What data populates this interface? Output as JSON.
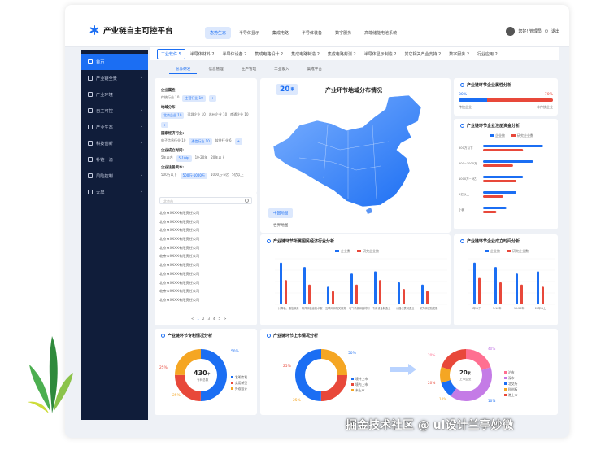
{
  "app": {
    "title": "产业链自主可控平台"
  },
  "topnav": [
    "态势生态",
    "半导体显示",
    "集成电路",
    "半导体装备",
    "数字服务",
    "高端储能电池系统"
  ],
  "user": {
    "name": "您好! 管理员",
    "logout": "退出"
  },
  "sidebar": [
    {
      "label": "首页",
      "icon": "home-icon"
    },
    {
      "label": "产业链全景",
      "icon": "network-icon"
    },
    {
      "label": "产业环境",
      "icon": "environment-icon"
    },
    {
      "label": "自主可控",
      "icon": "shield-icon"
    },
    {
      "label": "产业生态",
      "icon": "ecosystem-icon"
    },
    {
      "label": "科技创新",
      "icon": "innovation-icon"
    },
    {
      "label": "补链一滴",
      "icon": "chain-icon"
    },
    {
      "label": "风险控制",
      "icon": "risk-icon"
    },
    {
      "label": "大屏",
      "icon": "screen-icon"
    }
  ],
  "tabs_main": [
    "工业软件 5",
    "半导体材料 2",
    "半导体设备 2",
    "集成电路设计 2",
    "集成电路制造 2",
    "集成电路封测 2",
    "半导体显示制造 2",
    "其它相关产业支持 2",
    "数字服务 2",
    "行业应用 2"
  ],
  "tabs_sub": [
    "总体研发",
    "信息管理",
    "生产管理",
    "工业嵌入",
    "集成平台"
  ],
  "filter": {
    "groups": [
      {
        "title": "企业属性:",
        "chips": [
          "传统行业 10",
          "主营行业 10",
          "+"
        ]
      },
      {
        "title": "地域分布:",
        "chips": [
          "北京企业 10",
          "深圳企业 10",
          "苏州企业 10",
          "南通企业 10",
          "+"
        ]
      },
      {
        "title": "国家经济行业:",
        "chips": [
          "电子信息行业 10",
          "通信行业 10",
          "软件行业 6",
          "+"
        ]
      },
      {
        "title": "企业成立时间:",
        "chips": [
          "5年以内",
          "5-10年",
          "10-20年",
          "20年以上"
        ]
      },
      {
        "title": "企业注册资本:",
        "chips": [
          "500万以下",
          "500万-1000万",
          "1000万-5亿",
          "5亿以上"
        ]
      }
    ]
  },
  "company_list": {
    "search_placeholder": "北京市",
    "items": [
      "北京市XXXX有限责任公司",
      "北京市XXXX有限责任公司",
      "北京市XXXX有限责任公司",
      "北京市XXXX有限责任公司",
      "北京市XXXX有限责任公司",
      "北京市XXXX有限责任公司",
      "北京市XXXX有限责任公司",
      "北京市XXXX有限责任公司",
      "北京市XXXX有限责任公司",
      "北京市XXXX有限责任公司",
      "北京市XXXX有限责任公司"
    ],
    "pager": [
      "<",
      "1",
      "2",
      "3",
      "4",
      "5",
      ">"
    ]
  },
  "map": {
    "count": "20",
    "unit": "家",
    "title": "产业环节地域分布情况",
    "btn_china": "中国地图",
    "btn_world": "世界地图"
  },
  "attribute": {
    "title": "产业链环节企业属性分析",
    "left_pct": "30%",
    "right_pct": "70%",
    "left_label": "传统企业",
    "right_label": "非传统企业"
  },
  "capital": {
    "title": "产业链环节企业注册资金分析",
    "legend": [
      "企业数",
      "研究企业数"
    ],
    "categories": [
      "500万以下",
      "500~1000万",
      "1000万~5亿",
      "5亿以上",
      "小微"
    ],
    "colors": {
      "primary": "#1b6ef3",
      "secondary": "#e8483a"
    }
  },
  "econ": {
    "title": "产业链环节所属国民经济行业分析",
    "legend": [
      "企业数",
      "研究企业数"
    ],
    "categories": [
      "计算机、通信和其他电子设备",
      "软件和信息技术服务业",
      "互联网和相关服务",
      "电气机械和器材制造业",
      "专用设备制造业",
      "仪器仪表制造业",
      "研究和试验发展"
    ]
  },
  "founded": {
    "title": "产业链环节企业成立时间分析",
    "legend": [
      "企业数",
      "研究企业数"
    ],
    "categories": [
      "5年以下",
      "5-10年",
      "10-20年",
      "20年以上"
    ]
  },
  "patent": {
    "title": "产业链环节专利情况分析",
    "center_value": "430",
    "center_unit": "个",
    "center_label": "专利总数",
    "pct_top": "50%",
    "pct_left": "25%",
    "pct_bottom": "25%",
    "legend": [
      "发明专利",
      "实用新型",
      "外观设计"
    ]
  },
  "listing": {
    "title": "产业链环节上市情况分析",
    "left_pct_a": "25%",
    "left_pct_b": "50%",
    "left_pct_c": "25%",
    "legend_left": [
      "境外上市",
      "境内上市",
      "未上市"
    ],
    "right_center": "20",
    "right_unit": "家",
    "right_label": "上市企业",
    "right_pcts": [
      "20%",
      "40%",
      "10%",
      "10%",
      "20%"
    ],
    "legend_right": [
      "沪市",
      "深市",
      "北交所",
      "科创板",
      "港上市"
    ]
  },
  "watermark": "掘金技术社区 @ ui设计兰亭妙微"
}
